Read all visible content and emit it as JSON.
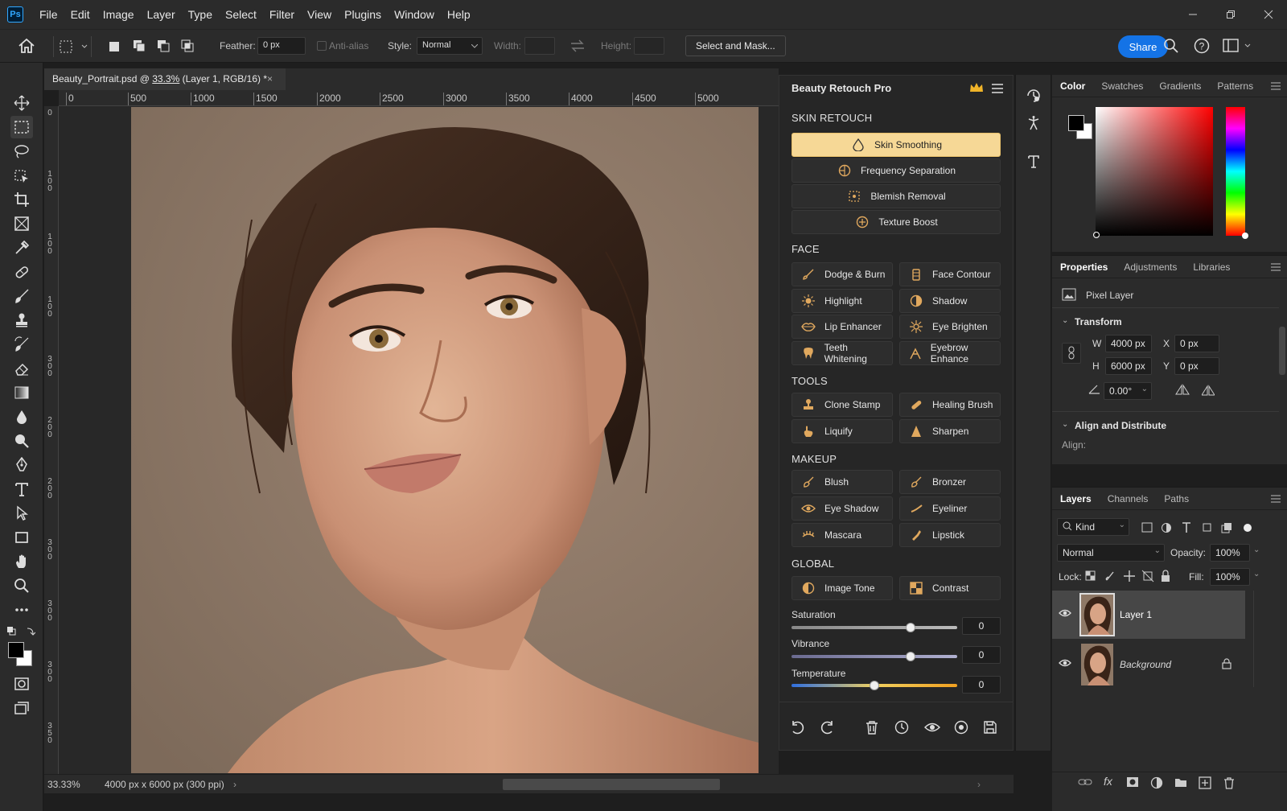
{
  "app": {
    "logo": "Ps"
  },
  "menu": [
    "File",
    "Edit",
    "Image",
    "Layer",
    "Type",
    "Select",
    "Filter",
    "View",
    "Plugins",
    "Window",
    "Help"
  ],
  "options": {
    "feather_label": "Feather:",
    "feather_value": "0 px",
    "antialias": "Anti-alias",
    "style_label": "Style:",
    "style_value": "Normal",
    "width_label": "Width:",
    "height_label": "Height:",
    "select_mask": "Select and Mask...",
    "share": "Share"
  },
  "document": {
    "tab_name": "Beauty_Portrait.psd @ ",
    "tab_zoom": "33.3%",
    "tab_rest": " (Layer 1, RGB/16) *",
    "ruler_h": [
      "0",
      "500",
      "1000",
      "1500",
      "2000",
      "2500",
      "3000",
      "3500",
      "4000",
      "4500",
      "5000"
    ],
    "ruler_v": [
      "0",
      "100",
      "100",
      "100",
      "300",
      "200",
      "200",
      "300",
      "300",
      "300",
      "350"
    ]
  },
  "status": {
    "zoom": "33.33%",
    "dims": "4000 px x 6000 px (300 ppi)"
  },
  "plugin": {
    "title": "Beauty Retouch Pro",
    "sections": {
      "skin": "SKIN RETOUCH",
      "face": "FACE",
      "tools": "TOOLS",
      "makeup": "MAKEUP",
      "global": "GLOBAL"
    },
    "skin": [
      "Skin Smoothing",
      "Frequency Separation",
      "Blemish Removal",
      "Texture Boost"
    ],
    "face": [
      "Dodge & Burn",
      "Face Contour",
      "Highlight",
      "Shadow",
      "Lip Enhancer",
      "Eye Brighten",
      "Teeth Whitening",
      "Eyebrow Enhance"
    ],
    "tools": [
      "Clone Stamp",
      "Healing Brush",
      "Liquify",
      "Sharpen"
    ],
    "makeup": [
      "Blush",
      "Bronzer",
      "Eye Shadow",
      "Eyeliner",
      "Mascara",
      "Lipstick"
    ],
    "global": [
      "Image Tone",
      "Contrast"
    ],
    "sliders": [
      {
        "label": "Saturation",
        "value": "0",
        "level": 0.72
      },
      {
        "label": "Vibrance",
        "value": "0",
        "level": 0.72
      },
      {
        "label": "Temperature",
        "value": "0",
        "level": 0.5
      }
    ]
  },
  "color_panel": {
    "tabs": [
      "Color",
      "Swatches",
      "Gradients",
      "Patterns"
    ],
    "hue": "#ff0000"
  },
  "properties": {
    "tabs": [
      "Properties",
      "Adjustments",
      "Libraries"
    ],
    "kind": "Pixel Layer",
    "transform": "Transform",
    "w_label": "W",
    "w": "4000 px",
    "h_label": "H",
    "h": "6000 px",
    "x_label": "X",
    "x": "0 px",
    "y_label": "Y",
    "y": "0 px",
    "angle": "0.00°",
    "align_title": "Align and Distribute",
    "align_label": "Align:"
  },
  "layers_panel": {
    "tabs": [
      "Layers",
      "Channels",
      "Paths"
    ],
    "kind": "Kind",
    "blend": "Normal",
    "opacity_label": "Opacity:",
    "opacity": "100%",
    "lock_label": "Lock:",
    "fill_label": "Fill:",
    "fill": "100%",
    "layers": [
      "Layer 1",
      "Background"
    ]
  }
}
